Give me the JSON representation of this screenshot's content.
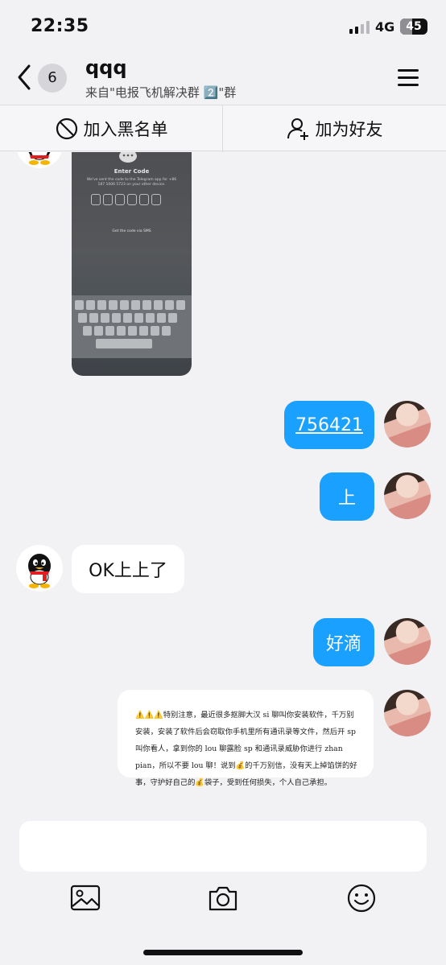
{
  "status_bar": {
    "time": "22:35",
    "network": "4G",
    "battery": "45"
  },
  "header": {
    "unread_count": "6",
    "chat_name": "qqq",
    "subtitle": "来自\"电报飞机解决群 2️⃣\"群"
  },
  "actions": {
    "block_label": "加入黑名单",
    "add_friend_label": "加为好友"
  },
  "photo_message": {
    "title": "Enter Code",
    "description": "We've sent the code to the Telegram app for +86 187 1006 5723 on your other device.",
    "sms_link": "Get the code via SMS"
  },
  "messages": [
    {
      "sender": "me",
      "text": "756421"
    },
    {
      "sender": "me",
      "text": "上"
    },
    {
      "sender": "other",
      "text": "OK上上了"
    },
    {
      "sender": "me",
      "text": "好滴"
    },
    {
      "sender": "me",
      "text": "⚠️⚠️⚠️特别注意，最近很多抠脚大汉 si 聊叫你安装软件，千万别安装，安装了软件后会窃取你手机里所有通讯录等文件，然后开 sp 叫你看人，拿到你的 lou 聊露脸 sp 和通讯录威胁你进行 zhan pian，所以不要 lou 聊！说到💰的千万别信，没有天上掉馅饼的好事，守护好自己的💰袋子，受到任何损失，个人自己承担。"
    }
  ],
  "input": {
    "placeholder": ""
  },
  "colors": {
    "accent": "#1aa0ff",
    "background": "#f2f2f4"
  },
  "icons": [
    "back-chevron-icon",
    "menu-icon",
    "block-icon",
    "add-user-icon",
    "image-icon",
    "camera-icon",
    "emoji-icon"
  ]
}
